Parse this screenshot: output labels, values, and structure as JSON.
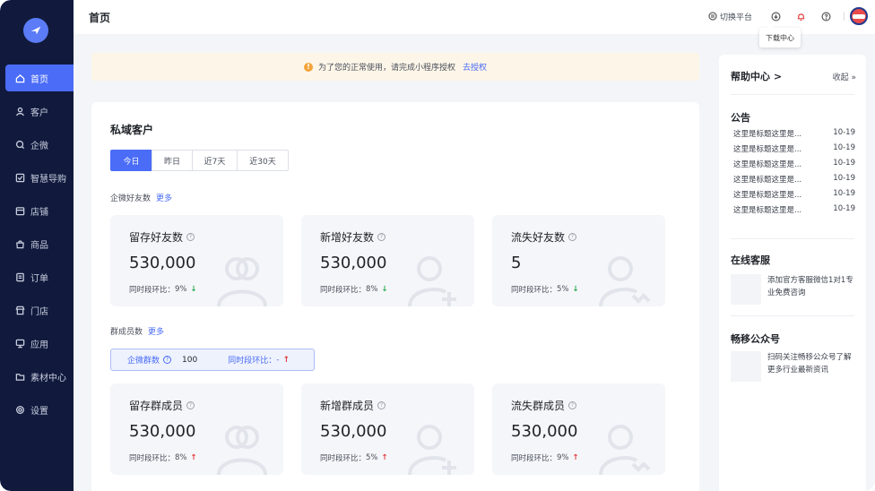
{
  "sidebar": {
    "items": [
      {
        "label": "首页",
        "icon": "home-icon",
        "active": true
      },
      {
        "label": "客户",
        "icon": "user-icon",
        "active": false
      },
      {
        "label": "企微",
        "icon": "chat-icon",
        "active": false
      },
      {
        "label": "智慧导购",
        "icon": "guide-icon",
        "active": false
      },
      {
        "label": "店铺",
        "icon": "store-icon",
        "active": false
      },
      {
        "label": "商品",
        "icon": "bag-icon",
        "active": false
      },
      {
        "label": "订单",
        "icon": "order-icon",
        "active": false
      },
      {
        "label": "门店",
        "icon": "shop-icon",
        "active": false
      },
      {
        "label": "应用",
        "icon": "monitor-icon",
        "active": false
      },
      {
        "label": "素材中心",
        "icon": "folder-icon",
        "active": false
      },
      {
        "label": "设置",
        "icon": "gear-icon",
        "active": false
      }
    ]
  },
  "header": {
    "title": "首页",
    "switch_platform": "切换平台",
    "tooltip": "下载中心"
  },
  "notice": {
    "text": "为了您的正常使用，请完成小程序授权",
    "link": "去授权"
  },
  "main": {
    "title": "私域客户",
    "tabs": [
      "今日",
      "昨日",
      "近7天",
      "近30天"
    ],
    "friends_label": "企微好友数",
    "more_label": "更多",
    "group_label": "群成员数",
    "friend_stats": [
      {
        "title": "留存好友数",
        "value": "530,000",
        "comp_label": "同时段环比：",
        "comp_value": "9%",
        "trend": "down"
      },
      {
        "title": "新增好友数",
        "value": "530,000",
        "comp_label": "同时段环比：",
        "comp_value": "8%",
        "trend": "down"
      },
      {
        "title": "流失好友数",
        "value": "5",
        "comp_label": "同时段环比：",
        "comp_value": "5%",
        "trend": "down"
      }
    ],
    "group_strip": {
      "label": "企微群数",
      "value": "100",
      "comp_label": "同时段环比：",
      "comp_value": "-"
    },
    "group_stats": [
      {
        "title": "留存群成员",
        "value": "530,000",
        "comp_label": "同时段环比：",
        "comp_value": "8%",
        "trend": "up"
      },
      {
        "title": "新增群成员",
        "value": "530,000",
        "comp_label": "同时段环比：",
        "comp_value": "5%",
        "trend": "up"
      },
      {
        "title": "流失群成员",
        "value": "530,000",
        "comp_label": "同时段环比：",
        "comp_value": "9%",
        "trend": "up"
      }
    ]
  },
  "right_panel": {
    "help_title": "帮助中心 >",
    "collapse": "收起 »",
    "announcement_title": "公告",
    "announcements": [
      {
        "title": "这里是标题这里是...",
        "date": "10-19"
      },
      {
        "title": "这里是标题这里是...",
        "date": "10-19"
      },
      {
        "title": "这里是标题这里是...",
        "date": "10-19"
      },
      {
        "title": "这里是标题这里是...",
        "date": "10-19"
      },
      {
        "title": "这里是标题这里是...",
        "date": "10-19"
      },
      {
        "title": "这里是标题这里是...",
        "date": "10-19"
      }
    ],
    "support_title": "在线客服",
    "support_text": "添加官方客服微信1对1专业免费咨询",
    "official_title": "畅移公众号",
    "official_text": "扫码关注畅移公众号了解更多行业最新资讯"
  },
  "colors": {
    "sidebar_bg": "#111a3d",
    "accent": "#4a6cf7",
    "notice_bg": "#fdf6e8",
    "down": "#22a94a",
    "up": "#e03b3b"
  }
}
